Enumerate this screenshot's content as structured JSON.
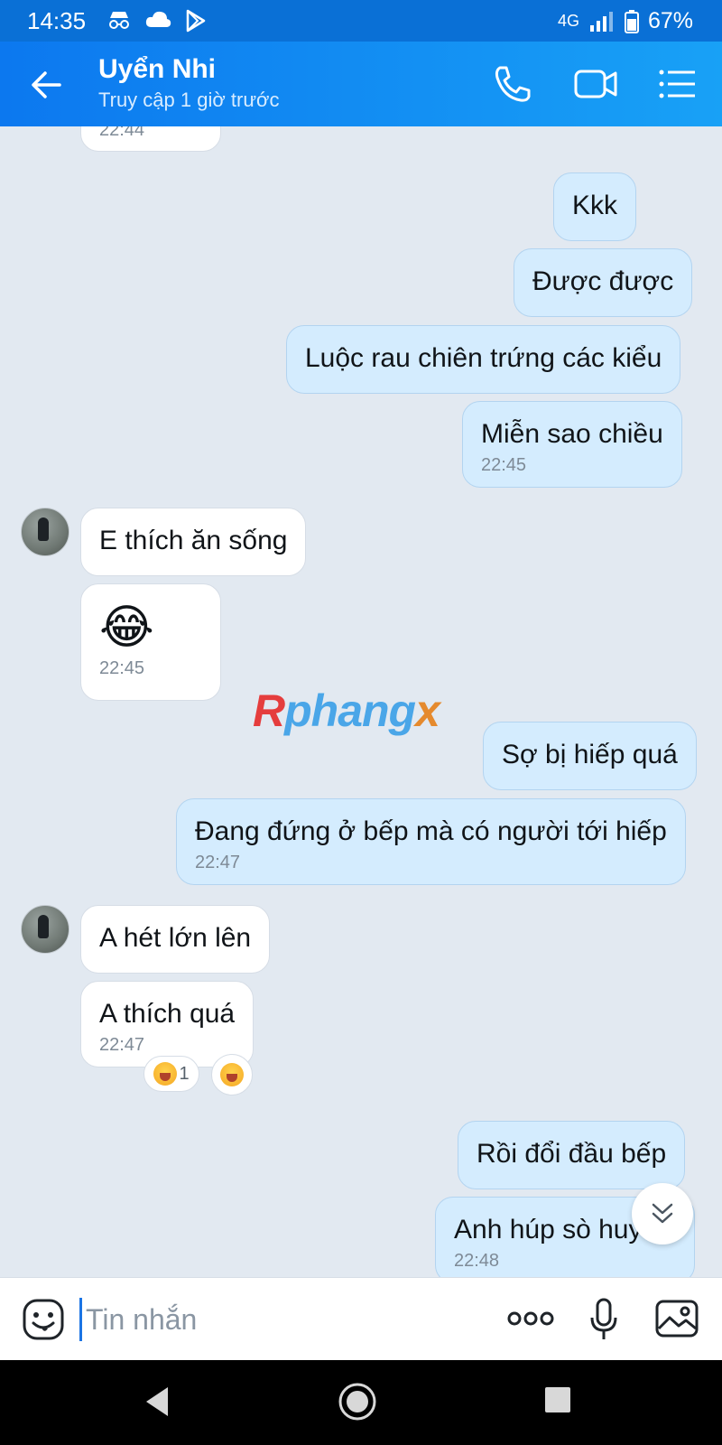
{
  "status_bar": {
    "time": "14:35",
    "network": "4G",
    "battery": "67%"
  },
  "header": {
    "name": "Uyển Nhi",
    "status": "Truy cập 1 giờ trước"
  },
  "messages": [
    {
      "side": "in",
      "time": "22:44"
    },
    {
      "side": "out",
      "text": "Kkk"
    },
    {
      "side": "out",
      "text": "Được được"
    },
    {
      "side": "out",
      "text": "Luộc rau chiên trứng các kiểu"
    },
    {
      "side": "out",
      "text": "Miễn sao chiều",
      "time": "22:45"
    },
    {
      "side": "in",
      "text": "E thích ăn sống"
    },
    {
      "side": "in",
      "text": "😂",
      "time": "22:45"
    },
    {
      "side": "out",
      "text": "Sợ bị hiếp quá"
    },
    {
      "side": "out",
      "text": "Đang đứng ở bếp mà có người tới hiếp",
      "time": "22:47"
    },
    {
      "side": "in",
      "text": "A hét lớn lên"
    },
    {
      "side": "in",
      "text": "A thích quá",
      "time": "22:47"
    },
    {
      "side": "out",
      "text": "Rồi đổi đầu bếp"
    },
    {
      "side": "out",
      "text": "Anh húp sò huy",
      "time": "22:48"
    }
  ],
  "reaction": {
    "count": "1"
  },
  "watermark": {
    "part1": "R",
    "part2": "phang",
    "part3": "x"
  },
  "input": {
    "placeholder": "Tin nhắn"
  },
  "icons": {
    "back": "arrow-left-icon",
    "call": "phone-icon",
    "video": "video-camera-icon",
    "menu": "list-menu-icon",
    "sticker": "sticker-face-icon",
    "more": "more-dots-icon",
    "mic": "microphone-icon",
    "image": "image-icon",
    "scroll": "chevron-double-down-icon"
  },
  "colors": {
    "header_start": "#0c78ef",
    "header_end": "#18a1f6",
    "outgoing_bubble": "#d4ecfe",
    "incoming_bubble": "#ffffff",
    "chat_bg": "#e2e9f1"
  }
}
